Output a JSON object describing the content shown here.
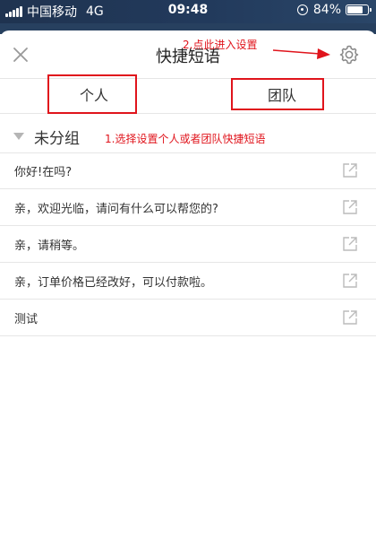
{
  "status_bar": {
    "carrier": "中国移动",
    "network": "4G",
    "time": "09:48",
    "battery_text": "84%",
    "battery_level": 0.84
  },
  "header": {
    "title": "快捷短语",
    "close_icon": "close-icon",
    "settings_icon": "gear-icon"
  },
  "tabs": [
    {
      "label": "个人"
    },
    {
      "label": "团队"
    }
  ],
  "group": {
    "label": "未分组",
    "icon": "caret-down-icon"
  },
  "phrases": [
    {
      "text": "你好!在吗?"
    },
    {
      "text": "亲，欢迎光临，请问有什么可以帮您的?"
    },
    {
      "text": "亲，请稍等。"
    },
    {
      "text": "亲，订单价格已经改好，可以付款啦。"
    },
    {
      "text": "测试"
    }
  ],
  "annotations": {
    "step1": "1.选择设置个人或者团队快捷短语",
    "step2": "2.点此进入设置",
    "color": "#e0141c"
  }
}
